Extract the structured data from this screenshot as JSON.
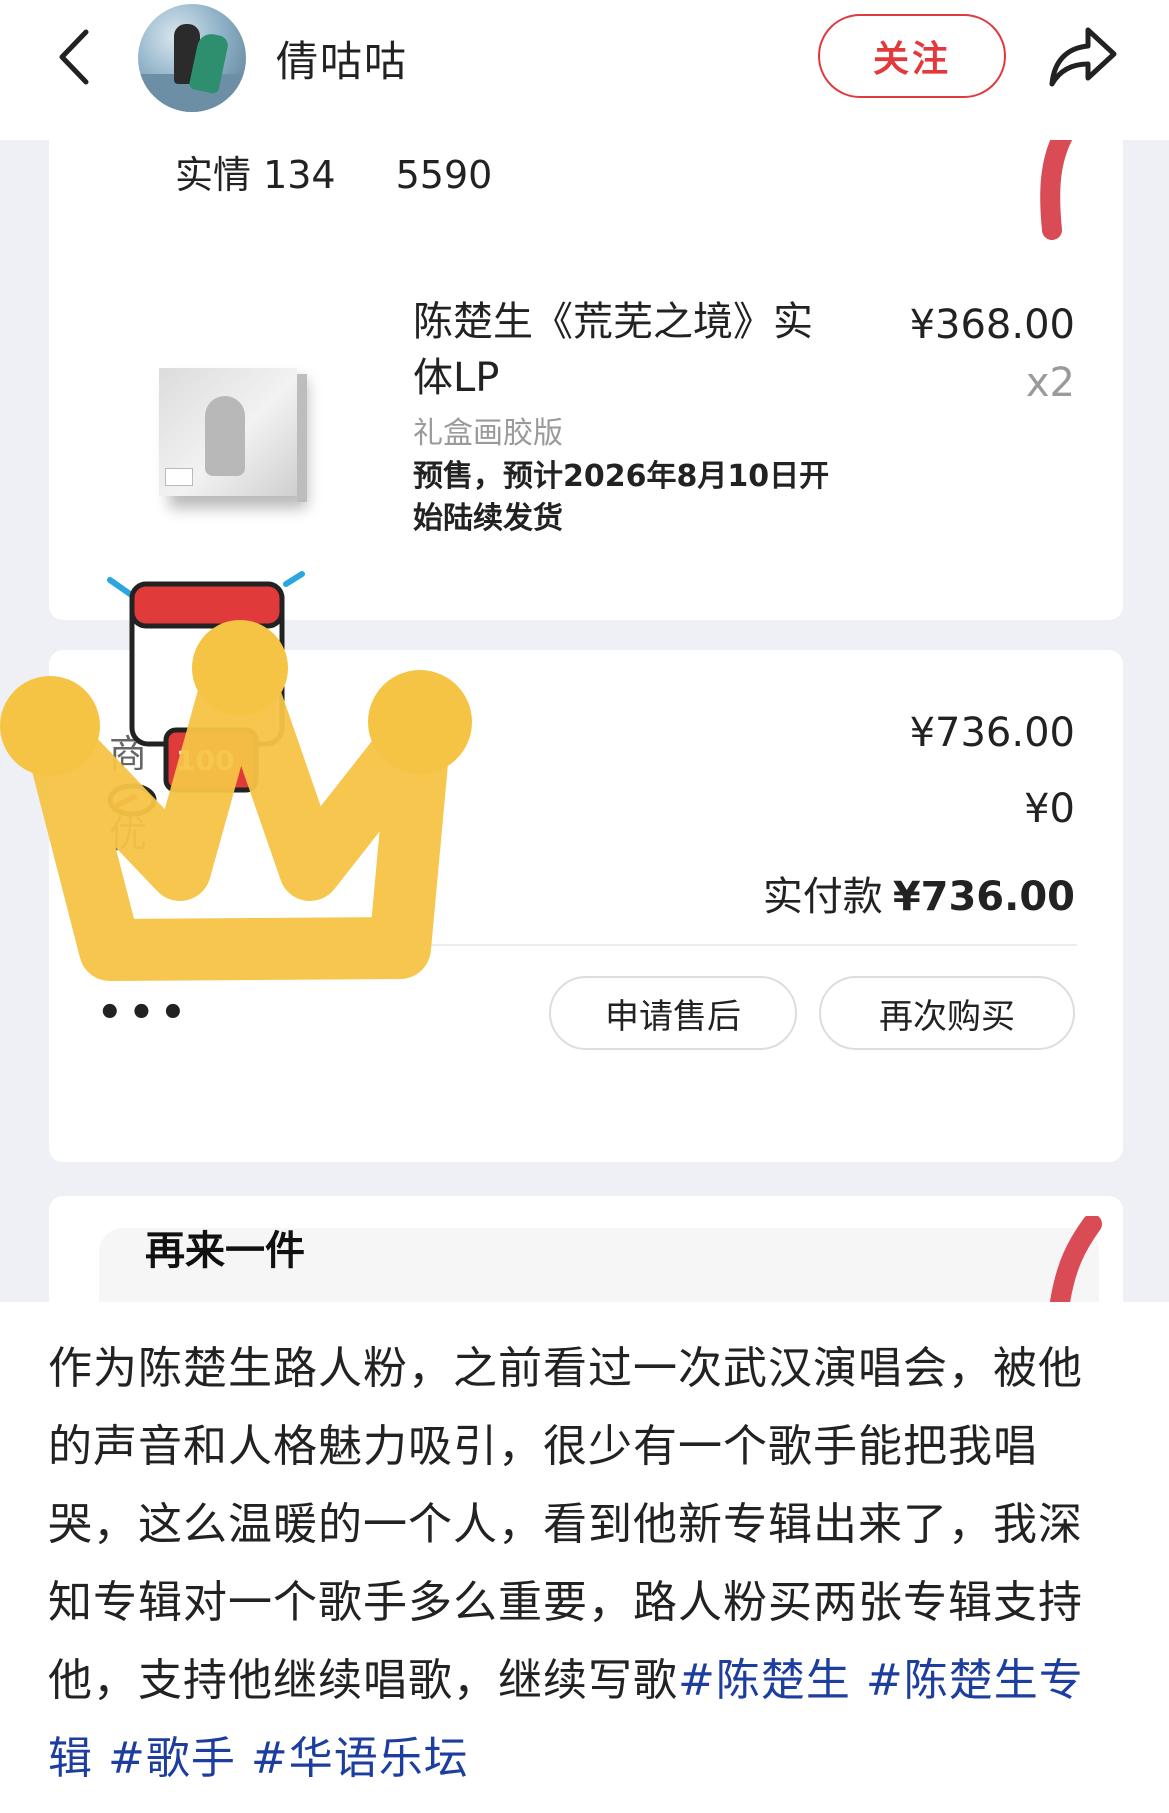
{
  "header": {
    "username": "倩咕咕",
    "follow_label": "关注"
  },
  "screenshot": {
    "cut_left": "实情 134",
    "cut_right": "5590",
    "product": {
      "title": "陈楚生《荒芜之境》实体LP",
      "price": "¥368.00",
      "quantity": "x2",
      "variant": "礼盒画胶版",
      "presale": "预售，预计2026年8月10日开始陆续发货"
    },
    "payment": {
      "label_partial_1": "商",
      "label_partial_2": "优",
      "total": "¥736.00",
      "discount": "¥0",
      "actual_label": "实付款",
      "actual_amount": "¥736.00"
    },
    "actions": {
      "more": "•••",
      "aftersale": "申请售后",
      "rebuy": "再次购买"
    },
    "again_title": "再来一件",
    "sticker_badge": "100"
  },
  "post": {
    "body": "作为陈楚生路人粉，之前看过一次武汉演唱会，被他的声音和人格魅力吸引，很少有一个歌手能把我唱哭，这么温暖的一个人，看到他新专辑出来了，我深知专辑对一个歌手多么重要，路人粉买两张专辑支持他，支持他继续唱歌，继续写歌",
    "tags": [
      "#陈楚生",
      "#陈楚生专辑",
      "#歌手",
      "#华语乐坛"
    ]
  },
  "colors": {
    "accent_red": "#e4393c",
    "tag_blue": "#1d3e9e",
    "crown_yellow": "#f6c445"
  }
}
